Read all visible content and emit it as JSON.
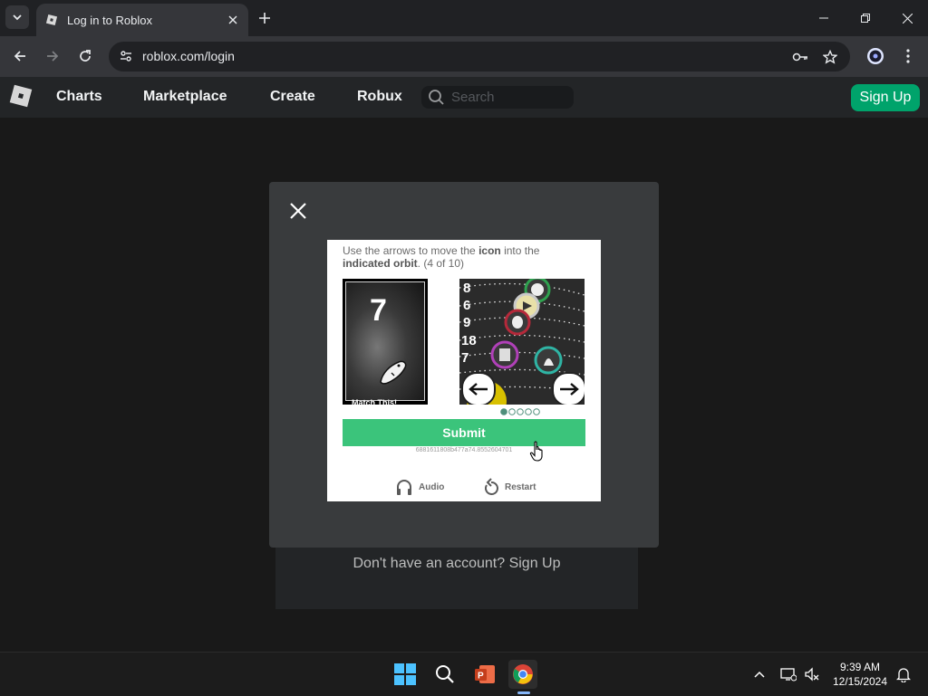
{
  "browser": {
    "tab_title": "Log in to Roblox",
    "url": "roblox.com/login"
  },
  "roblox_header": {
    "nav": [
      "Charts",
      "Marketplace",
      "Create",
      "Robux"
    ],
    "search_placeholder": "Search",
    "signup_label": "Sign Up",
    "signup_color": "#00a36b"
  },
  "login_card": {
    "signup_prompt": "Don't have an account? Sign Up"
  },
  "captcha": {
    "instruction_pre": "Use the arrows to move the ",
    "instruction_icon": "icon",
    "instruction_mid": " into the ",
    "instruction_orbit": "indicated orbit",
    "instruction_post": ". (4 of 10)",
    "reference_number": "7",
    "reference_label": "Match This!",
    "orbit_numbers": [
      "8",
      "6",
      "9",
      "18",
      "7"
    ],
    "page_count": 5,
    "page_active": 1,
    "submit_label": "Submit",
    "session_id": "6881611808b477a74.8552604701",
    "audio_label": "Audio",
    "restart_label": "Restart",
    "submit_color": "#3bc47b"
  },
  "taskbar": {
    "apps": [
      "windows-start",
      "search",
      "powerpoint",
      "chrome"
    ],
    "time": "9:39 AM",
    "date": "12/15/2024"
  }
}
